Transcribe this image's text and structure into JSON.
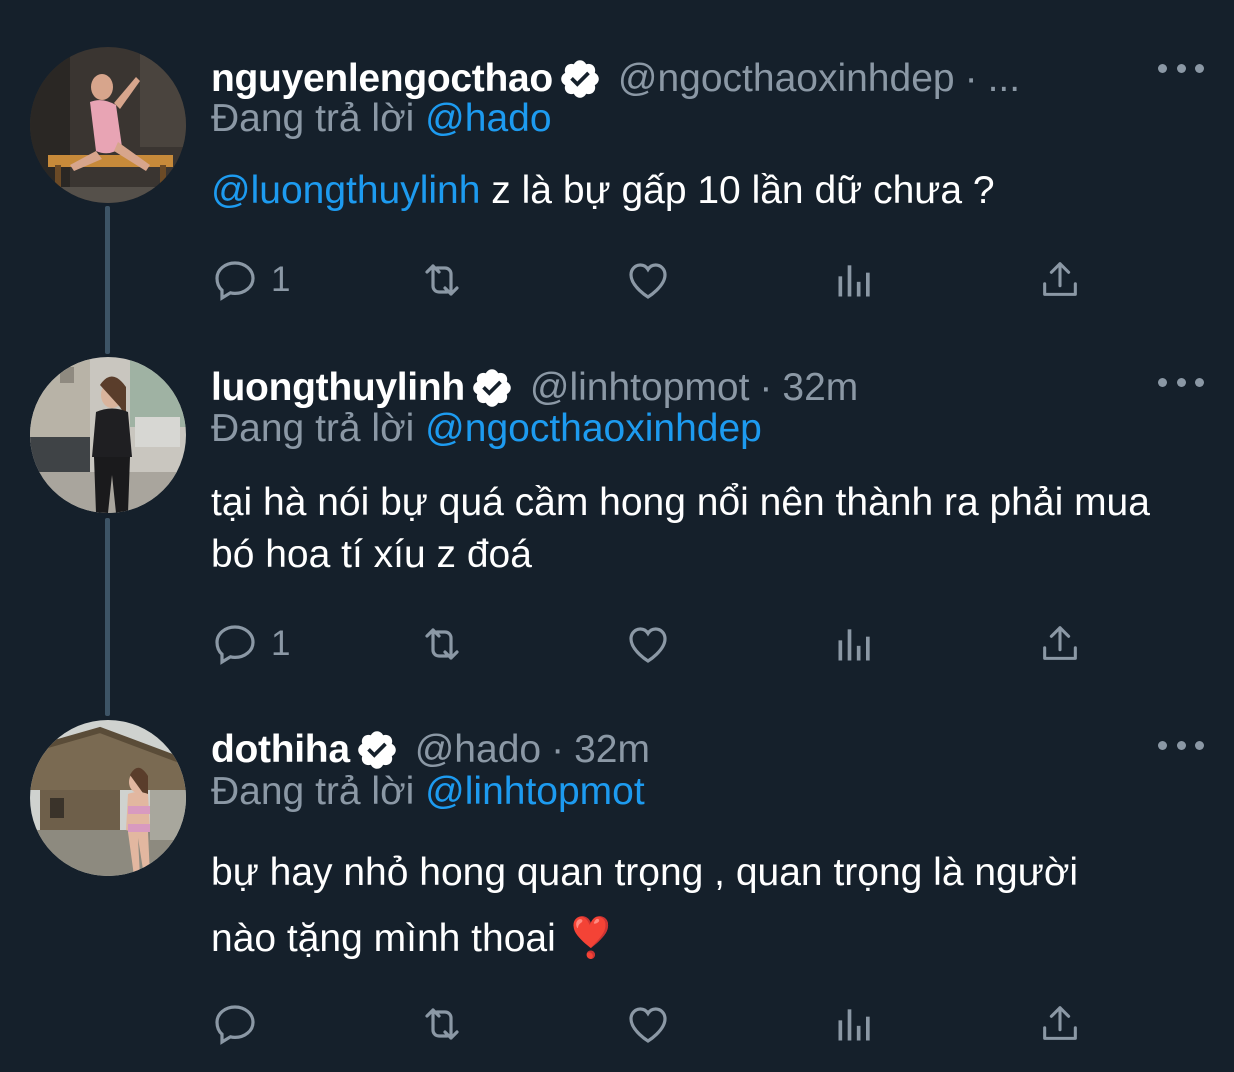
{
  "tweets": [
    {
      "display_name": "nguyenlengocthao",
      "handle": "@ngocthaoxinhdep",
      "time": "...",
      "reply_prefix": "Đang trả lời",
      "reply_to": "@hado",
      "text_mention": "@luongthuylinh",
      "text": " z là bự gấp 10 lần dữ chưa ?",
      "reply_count": "1",
      "avatar_icon": "photo-avatar-icon"
    },
    {
      "display_name": "luongthuylinh",
      "handle": "@linhtopmot",
      "time": "32m",
      "reply_prefix": "Đang trả lời",
      "reply_to": "@ngocthaoxinhdep",
      "text": "tại hà nói bự quá cầm hong nổi nên thành ra phải mua bó hoa tí xíu z đoá",
      "reply_count": "1",
      "avatar_icon": "photo-avatar-icon"
    },
    {
      "display_name": "dothiha",
      "handle": "@hado",
      "time": "32m",
      "reply_prefix": "Đang trả lời",
      "reply_to": "@linhtopmot",
      "text_line1": "bự hay nhỏ hong quan trọng , quan trọng là người",
      "text_line2": "nào tặng mình thoai ",
      "emoji": "❣️",
      "reply_count": "",
      "avatar_icon": "photo-avatar-icon"
    }
  ],
  "separator": "·",
  "colors": {
    "background": "#15202b",
    "text": "#ffffff",
    "muted": "#8b98a5",
    "link": "#1d9bf0",
    "thread_line": "#3d5466"
  }
}
